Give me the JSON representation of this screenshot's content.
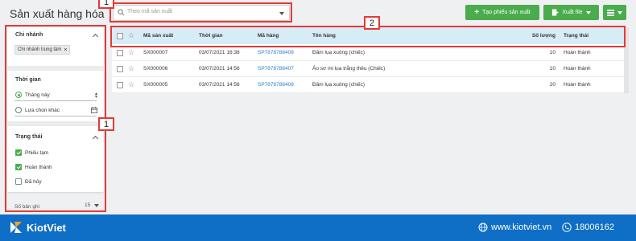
{
  "header": {
    "title": "Sản xuất hàng hóa",
    "search_placeholder": "Theo mã sản xuất",
    "create_button": "Tạo phiếu sản xuất",
    "export_button": "Xuất file"
  },
  "sidebar": {
    "branch": {
      "title": "Chi nhánh",
      "tag": "Chi nhánh trung tâm"
    },
    "time": {
      "title": "Thời gian",
      "option_this_month": "Tháng này",
      "option_custom": "Lựa chọn khác"
    },
    "status": {
      "title": "Trạng thái",
      "options": [
        "Phiếu tạm",
        "Hoàn thành",
        "Đã hủy"
      ]
    },
    "records": {
      "label": "Số bản ghi",
      "value": "15"
    }
  },
  "table": {
    "headers": {
      "code": "Mã sản xuất",
      "time": "Thời gian",
      "product_code": "Mã hàng",
      "product_name": "Tên hàng",
      "quantity": "Số lượng",
      "status": "Trạng thái"
    },
    "rows": [
      {
        "code": "SX000007",
        "time": "03/07/2021 16:38",
        "product_code": "SP7878788408",
        "product_name": "Đầm lụa xuông (chiếc)",
        "quantity": "10",
        "status": "Hoàn thành"
      },
      {
        "code": "SX000006",
        "time": "03/07/2021 14:56",
        "product_code": "SP7878788407",
        "product_name": "Áo sơ mi lụa trắng thêu (Chiếc)",
        "quantity": "10",
        "status": "Hoàn thành"
      },
      {
        "code": "SX000005",
        "time": "03/07/2021 14:56",
        "product_code": "SP7878788408",
        "product_name": "Đầm lụa xuông (chiếc)",
        "quantity": "20",
        "status": "Hoàn thành"
      }
    ]
  },
  "annotations": {
    "label_1": "1",
    "label_2": "2"
  },
  "footer": {
    "brand": "KiotViet",
    "website": "www.kiotviet.vn",
    "phone": "18006162"
  },
  "colors": {
    "primary_green": "#4bac4d",
    "header_blue": "#d6ecf7",
    "footer_blue": "#0f6fc6",
    "link_blue": "#2a7fd4",
    "annotation_red": "#e53935"
  }
}
